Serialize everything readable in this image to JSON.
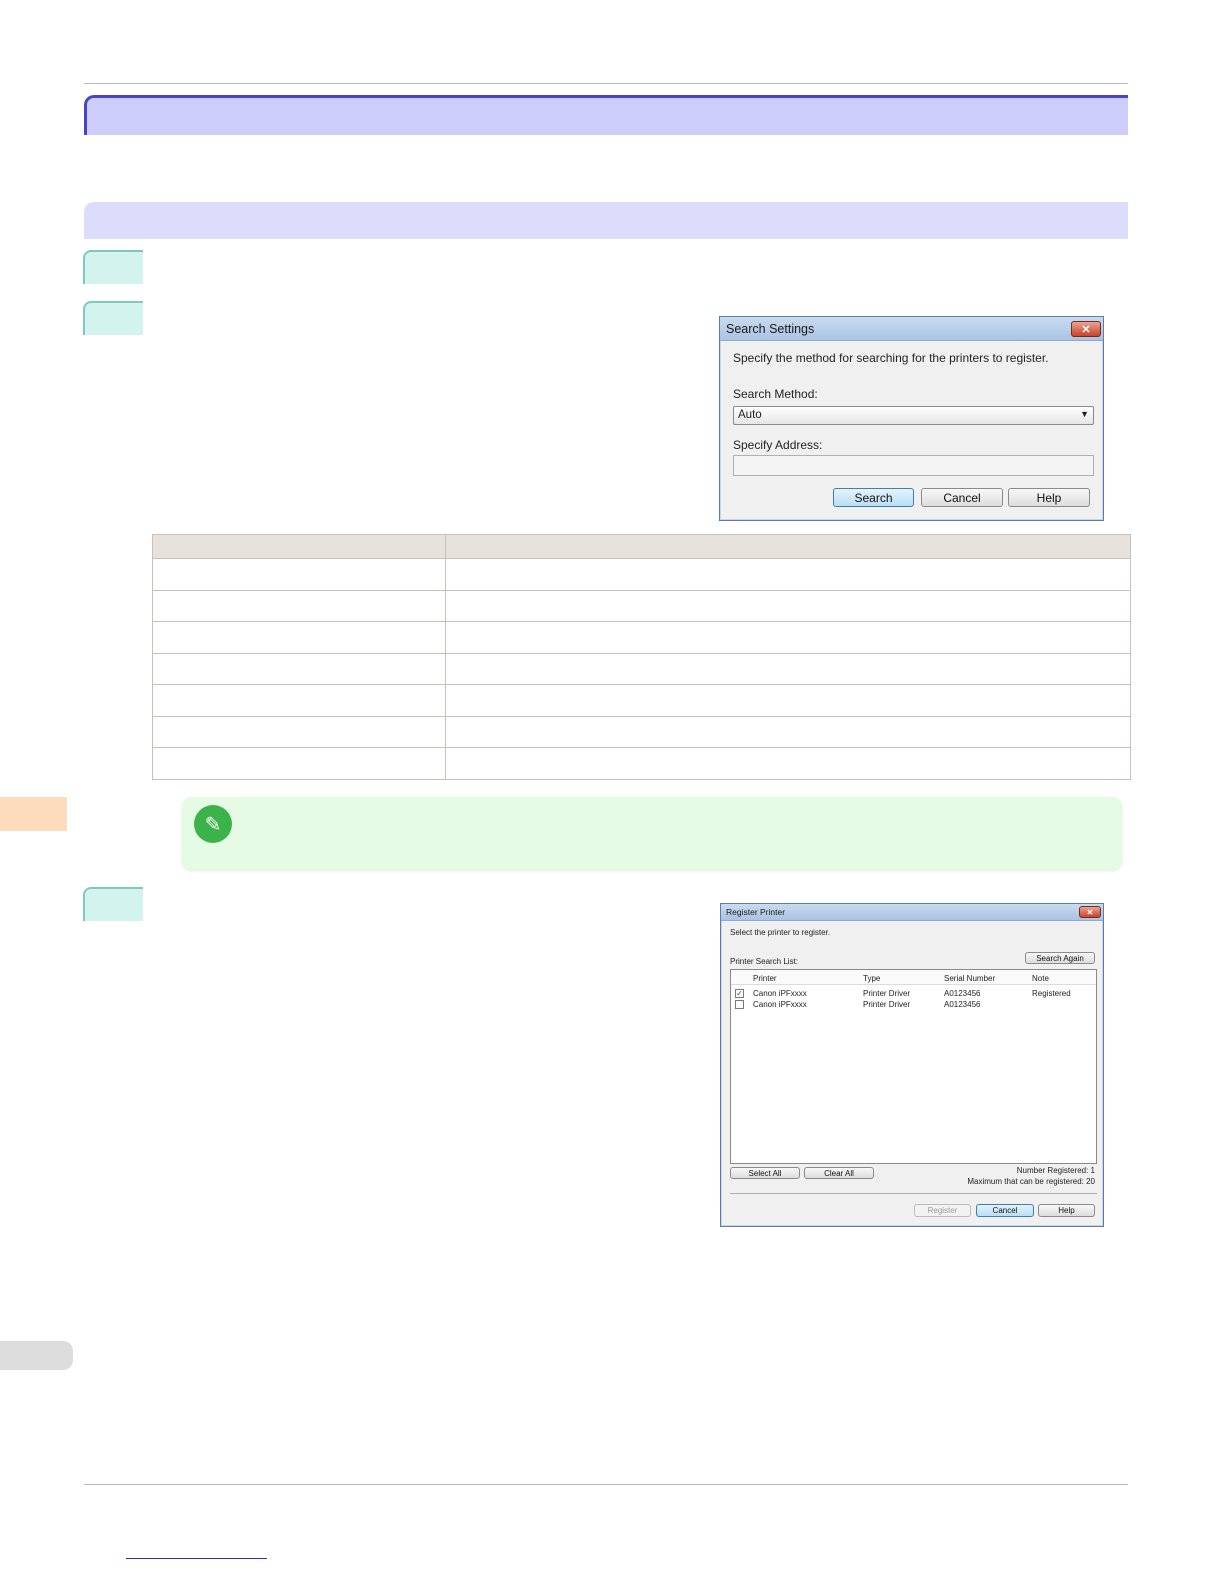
{
  "search_dialog": {
    "title": "Search Settings",
    "instruction": "Specify the method for searching for the printers to register.",
    "method_label": "Search Method:",
    "method_value": "Auto",
    "address_label": "Specify Address:",
    "address_value": "",
    "buttons": {
      "search": "Search",
      "cancel": "Cancel",
      "help": "Help"
    }
  },
  "register_dialog": {
    "title": "Register Printer",
    "instruction": "Select the printer to register.",
    "list_label": "Printer Search List:",
    "search_again": "Search Again",
    "columns": [
      "Printer",
      "Type",
      "Serial Number",
      "Note"
    ],
    "rows": [
      {
        "checked": true,
        "printer": "Canon iPFxxxx",
        "type": "Printer Driver",
        "serial": "A0123456",
        "note": "Registered"
      },
      {
        "checked": false,
        "printer": "Canon iPFxxxx",
        "type": "Printer Driver",
        "serial": "A0123456",
        "note": ""
      }
    ],
    "select_all": "Select All",
    "clear_all": "Clear All",
    "number_registered": "Number Registered: 1",
    "max_registered": "Maximum that can be registered: 20",
    "buttons": {
      "register": "Register",
      "cancel": "Cancel",
      "help": "Help"
    }
  },
  "colors": {
    "title_bar": "#cccdfb",
    "section_bar": "#dcdcfb",
    "step_tab": "#d2f3ee",
    "note_bg": "#e6fbe3",
    "side_tab": "#fcdcbc"
  },
  "icons": {
    "note": "pencil-icon",
    "close": "close-icon",
    "dropdown": "chevron-down-icon"
  }
}
